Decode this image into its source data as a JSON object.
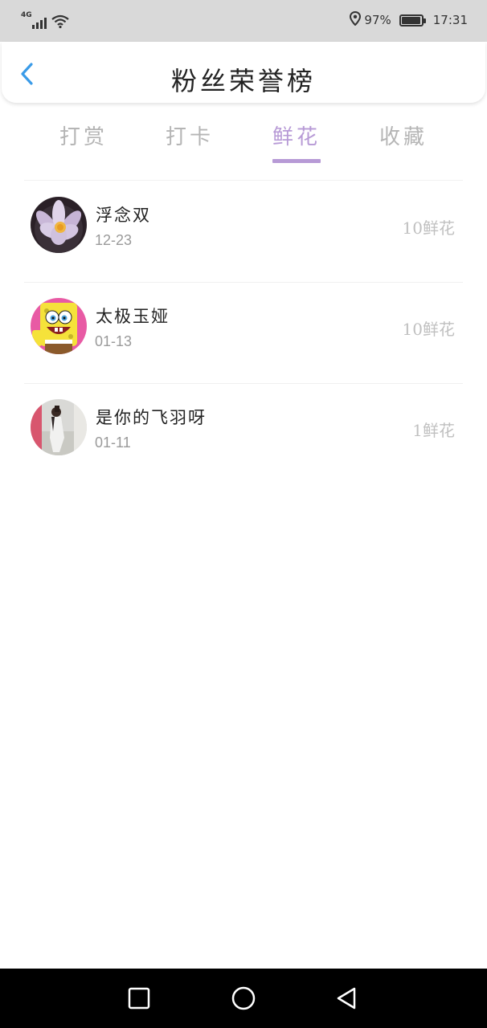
{
  "status_bar": {
    "network": "4G",
    "signal_bars": 4,
    "battery_percent": "97%",
    "battery_level": 0.97,
    "time": "17:31",
    "icons": [
      "location-icon",
      "wifi-icon",
      "signal-icon",
      "battery-icon"
    ]
  },
  "header": {
    "title": "粉丝荣誉榜",
    "back_icon": "chevron-left-icon",
    "accent_color": "#3a9be8"
  },
  "tabs": [
    {
      "label": "打赏",
      "active": false
    },
    {
      "label": "打卡",
      "active": false
    },
    {
      "label": "鲜花",
      "active": true
    },
    {
      "label": "收藏",
      "active": false
    }
  ],
  "active_tab_color": "#b79ad6",
  "fans": [
    {
      "name": "浮念双",
      "date": "12-23",
      "amount": "10鲜花",
      "avatar": "lotus-flower-avatar"
    },
    {
      "name": "太极玉娅",
      "date": "01-13",
      "amount": "10鲜花",
      "avatar": "spongebob-avatar"
    },
    {
      "name": "是你的飞羽呀",
      "date": "01-11",
      "amount": "1鲜花",
      "avatar": "person-photo-avatar"
    }
  ],
  "nav_bar": {
    "buttons": [
      "recent-apps-button",
      "home-button",
      "back-button"
    ]
  }
}
